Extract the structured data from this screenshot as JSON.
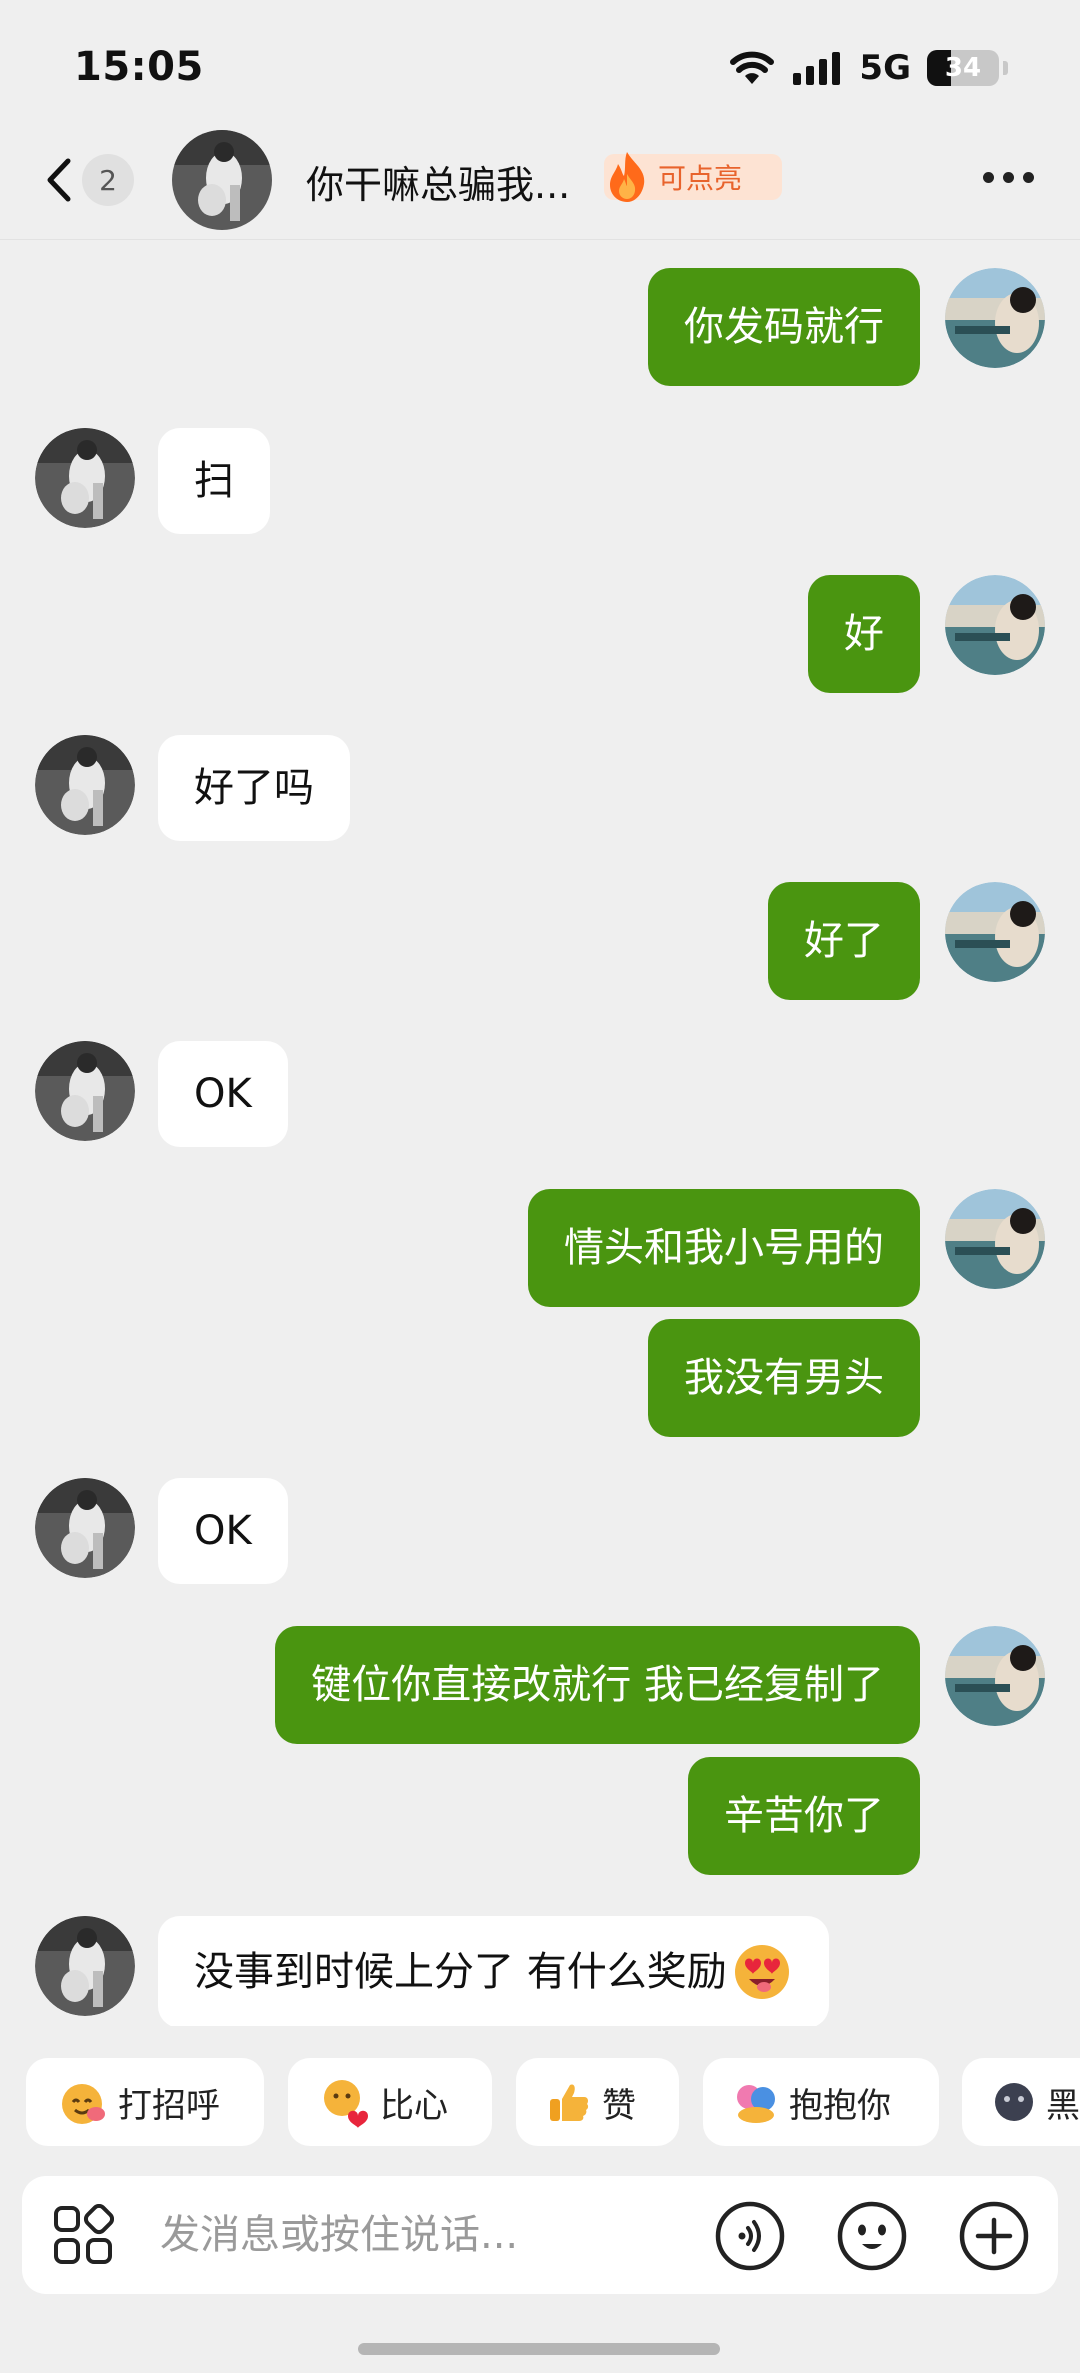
{
  "status": {
    "time": "15:05",
    "network": "5G",
    "battery_level": "34",
    "battery_fraction": 0.34
  },
  "header": {
    "back_count": "2",
    "title": "你干嘛总骗我...",
    "badge": "可点亮"
  },
  "messages": [
    {
      "side": "out",
      "text": "你发码就行"
    },
    {
      "side": "in",
      "text": "扫"
    },
    {
      "side": "out",
      "text": "好"
    },
    {
      "side": "in",
      "text": "好了吗"
    },
    {
      "side": "out",
      "text": "好了"
    },
    {
      "side": "in",
      "text": "OK"
    },
    {
      "side": "out",
      "text": "情头和我小号用的"
    },
    {
      "side": "out",
      "text": "我没有男头"
    },
    {
      "side": "in",
      "text": "OK"
    },
    {
      "side": "out",
      "text": "键位你直接改就行 我已经复制了"
    },
    {
      "side": "out",
      "text": "辛苦你了"
    },
    {
      "side": "in",
      "text": "没事到时候上分了 有什么奖励"
    }
  ],
  "quick_replies": [
    {
      "label": "打招呼",
      "icon": "wave-emoji-icon"
    },
    {
      "label": "比心",
      "icon": "heart-hands-emoji-icon"
    },
    {
      "label": "赞",
      "icon": "thumbs-up-emoji-icon"
    },
    {
      "label": "抱抱你",
      "icon": "hug-emoji-icon"
    },
    {
      "label": "黑",
      "icon": "dark-face-emoji-icon"
    }
  ],
  "input": {
    "placeholder": "发消息或按住说话..."
  },
  "colors": {
    "outgoing_bubble": "#4a9510",
    "incoming_bubble": "#ffffff",
    "background": "#efefef",
    "badge_text": "#e8632c"
  }
}
